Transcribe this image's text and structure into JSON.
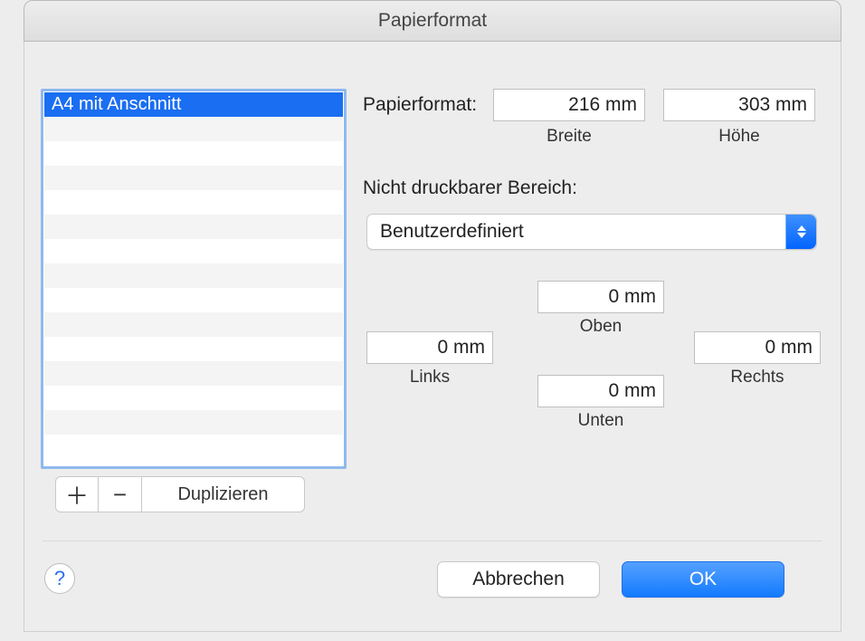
{
  "window": {
    "title": "Papierformat"
  },
  "list": {
    "items": [
      "A4 mit Anschnitt"
    ],
    "selected_index": 0,
    "duplicate_label": "Duplizieren"
  },
  "labels": {
    "paper_size": "Papierformat:",
    "width": "Breite",
    "height": "Höhe",
    "non_printable": "Nicht druckbarer Bereich:",
    "top": "Oben",
    "bottom": "Unten",
    "left": "Links",
    "right": "Rechts"
  },
  "size": {
    "width": "216 mm",
    "height": "303 mm"
  },
  "non_printable": {
    "selected": "Benutzerdefiniert"
  },
  "margins": {
    "top": "0 mm",
    "bottom": "0 mm",
    "left": "0 mm",
    "right": "0 mm"
  },
  "buttons": {
    "cancel": "Abbrechen",
    "ok": "OK"
  }
}
